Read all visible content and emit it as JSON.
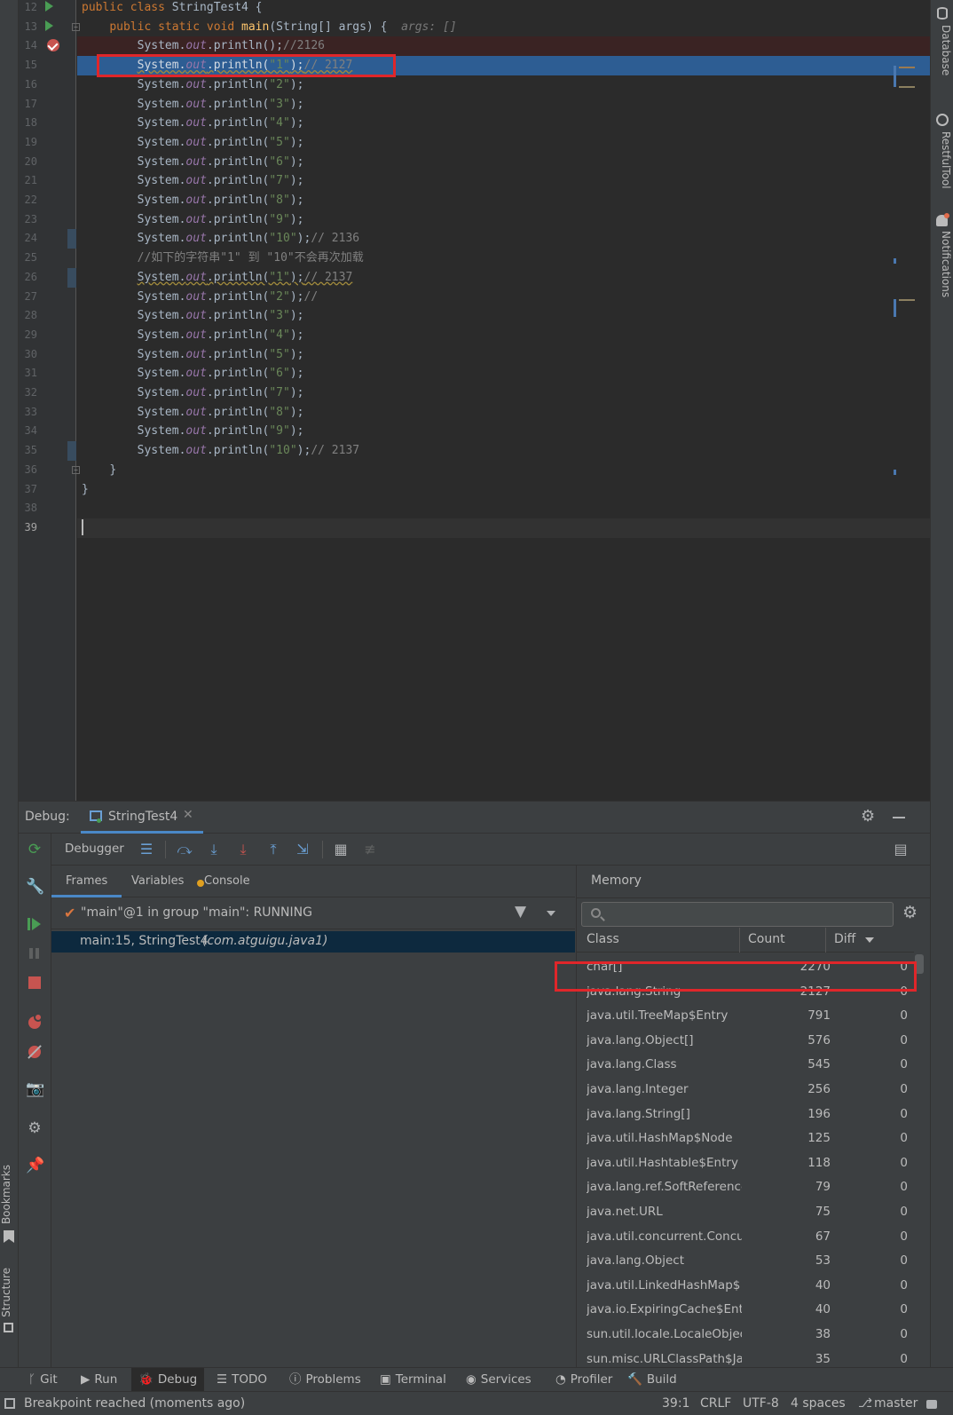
{
  "editor": {
    "lines": [
      {
        "n": "12",
        "run": true
      },
      {
        "n": "13",
        "run": true,
        "fold": true,
        "hint": "args: []"
      },
      {
        "n": "14",
        "bp": true
      },
      {
        "n": "15"
      },
      {
        "n": "16"
      },
      {
        "n": "17"
      },
      {
        "n": "18"
      },
      {
        "n": "19"
      },
      {
        "n": "20"
      },
      {
        "n": "21"
      },
      {
        "n": "22"
      },
      {
        "n": "23"
      },
      {
        "n": "24"
      },
      {
        "n": "25"
      },
      {
        "n": "26"
      },
      {
        "n": "27"
      },
      {
        "n": "28"
      },
      {
        "n": "29"
      },
      {
        "n": "30"
      },
      {
        "n": "31"
      },
      {
        "n": "32"
      },
      {
        "n": "33"
      },
      {
        "n": "34"
      },
      {
        "n": "35"
      },
      {
        "n": "36",
        "fold": true
      },
      {
        "n": "37"
      },
      {
        "n": "38"
      },
      {
        "n": "39"
      }
    ],
    "class_decl": {
      "kw": "public class ",
      "name": "StringTest4 {"
    },
    "main_decl": {
      "kw": "public static void ",
      "fn": "main",
      "rest": "(String[] args) {",
      "hint": "args: []"
    },
    "println_prefix": "System.",
    "out": "out",
    "println": ".println(",
    "line14": {
      "rest": "();",
      "comment": "//2126"
    },
    "line15": {
      "str": "\"1\"",
      "comment": "// 2127"
    },
    "strings_a": [
      "\"2\"",
      "\"3\"",
      "\"4\"",
      "\"5\"",
      "\"6\"",
      "\"7\"",
      "\"8\"",
      "\"9\""
    ],
    "line24": {
      "str": "\"10\"",
      "comment": "// 2136"
    },
    "line25_comment": "//如下的字符串\"1\" 到 \"10\"不会再次加载",
    "line26": {
      "str": "\"1\"",
      "comment": "// 2137"
    },
    "line27": {
      "str": "\"2\"",
      "comment": "//"
    },
    "strings_b": [
      "\"3\"",
      "\"4\"",
      "\"5\"",
      "\"6\"",
      "\"7\"",
      "\"8\"",
      "\"9\""
    ],
    "line35": {
      "str": "\"10\"",
      "comment": "// 2137"
    },
    "close_method": "}",
    "close_class": "}"
  },
  "right_tools": {
    "database": "Database",
    "restful": "RestfulTool",
    "notifications": "Notifications"
  },
  "left_tools": {
    "bookmarks": "Bookmarks",
    "structure": "Structure"
  },
  "debug": {
    "label": "Debug:",
    "session_tab": "StringTest4",
    "toolbar_label": "Debugger",
    "tabs": {
      "frames": "Frames",
      "variables": "Variables",
      "console": "Console"
    },
    "thread": "\"main\"@1 in group \"main\": RUNNING",
    "frame": {
      "location": "main:15, StringTest4",
      "package": "(com.atguigu.java1)"
    },
    "memory": {
      "title": "Memory",
      "search_placeholder": "",
      "columns": {
        "class": "Class",
        "count": "Count",
        "diff": "Diff"
      },
      "rows": [
        {
          "cls": "char[]",
          "count": "2270",
          "diff": "0"
        },
        {
          "cls": "java.lang.String",
          "count": "2127",
          "diff": "0"
        },
        {
          "cls": "java.util.TreeMap$Entry",
          "count": "791",
          "diff": "0"
        },
        {
          "cls": "java.lang.Object[]",
          "count": "576",
          "diff": "0"
        },
        {
          "cls": "java.lang.Class",
          "count": "545",
          "diff": "0"
        },
        {
          "cls": "java.lang.Integer",
          "count": "256",
          "diff": "0"
        },
        {
          "cls": "java.lang.String[]",
          "count": "196",
          "diff": "0"
        },
        {
          "cls": "java.util.HashMap$Node",
          "count": "125",
          "diff": "0"
        },
        {
          "cls": "java.util.Hashtable$Entry",
          "count": "118",
          "diff": "0"
        },
        {
          "cls": "java.lang.ref.SoftReference",
          "count": "79",
          "diff": "0"
        },
        {
          "cls": "java.net.URL",
          "count": "75",
          "diff": "0"
        },
        {
          "cls": "java.util.concurrent.Concu",
          "count": "67",
          "diff": "0"
        },
        {
          "cls": "java.lang.Object",
          "count": "53",
          "diff": "0"
        },
        {
          "cls": "java.util.LinkedHashMap$",
          "count": "40",
          "diff": "0"
        },
        {
          "cls": "java.io.ExpiringCache$Entr",
          "count": "40",
          "diff": "0"
        },
        {
          "cls": "sun.util.locale.LocaleObjec",
          "count": "38",
          "diff": "0"
        },
        {
          "cls": "sun.misc.URLClassPath$Jar",
          "count": "35",
          "diff": "0"
        }
      ]
    }
  },
  "tool_windows": [
    {
      "icon": "git-icon",
      "label": "Git"
    },
    {
      "icon": "run-icon",
      "label": "Run"
    },
    {
      "icon": "debug-icon",
      "label": "Debug"
    },
    {
      "icon": "todo-icon",
      "label": "TODO"
    },
    {
      "icon": "problems-icon",
      "label": "Problems"
    },
    {
      "icon": "terminal-icon",
      "label": "Terminal"
    },
    {
      "icon": "services-icon",
      "label": "Services"
    },
    {
      "icon": "profiler-icon",
      "label": "Profiler"
    },
    {
      "icon": "build-icon",
      "label": "Build"
    }
  ],
  "status": {
    "message": "Breakpoint reached (moments ago)",
    "position": "39:1",
    "line_ending": "CRLF",
    "encoding": "UTF-8",
    "indent": "4 spaces",
    "branch": "master"
  },
  "colors": {
    "highlight_box": "#e0262a",
    "exec_line": "#2d5d93",
    "breakpoint": "#c75450"
  }
}
